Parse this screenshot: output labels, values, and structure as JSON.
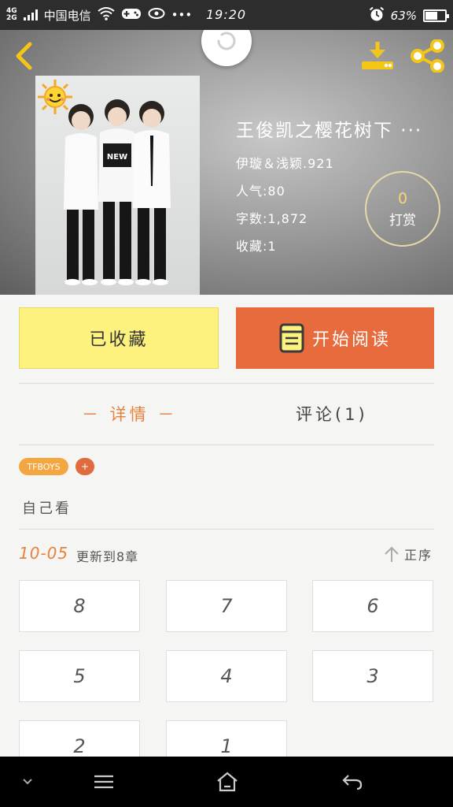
{
  "status_bar": {
    "network_top": "4G",
    "network_bottom": "2G",
    "carrier": "中国电信",
    "more": "•••",
    "time": "19:20",
    "battery_text": "63%",
    "battery_level": 0.63
  },
  "header": {
    "title": "王俊凯之樱花树下 ···",
    "author": "伊璇＆浅颖.921",
    "popularity": "人气:80",
    "word_count": "字数:1,872",
    "favorites": "收藏:1",
    "reward_count": "0",
    "reward_label": "打赏"
  },
  "actions": {
    "collected_label": "已收藏",
    "read_label": "开始阅读"
  },
  "tabs": {
    "details": "－ 详情 －",
    "comments": "评论(1)"
  },
  "tags": {
    "tfboys": "TFBOYS",
    "add": "+"
  },
  "description": "自己看",
  "update": {
    "date": "10-05",
    "text": "更新到8章",
    "sort_label": "正序"
  },
  "chapters": [
    "8",
    "7",
    "6",
    "5",
    "4",
    "3",
    "2",
    "1"
  ],
  "colors": {
    "accent_orange": "#e86b3e",
    "highlight_orange": "#e8823f",
    "collected_yellow": "#fdf27d",
    "icon_yellow": "#f5c518"
  },
  "icons": {
    "back": "chevron-left-icon",
    "download": "download-icon",
    "share": "share-icon",
    "refresh": "refresh-icon",
    "book": "book-icon",
    "sort": "arrow-up-icon",
    "sun": "sun-sticker-icon"
  }
}
